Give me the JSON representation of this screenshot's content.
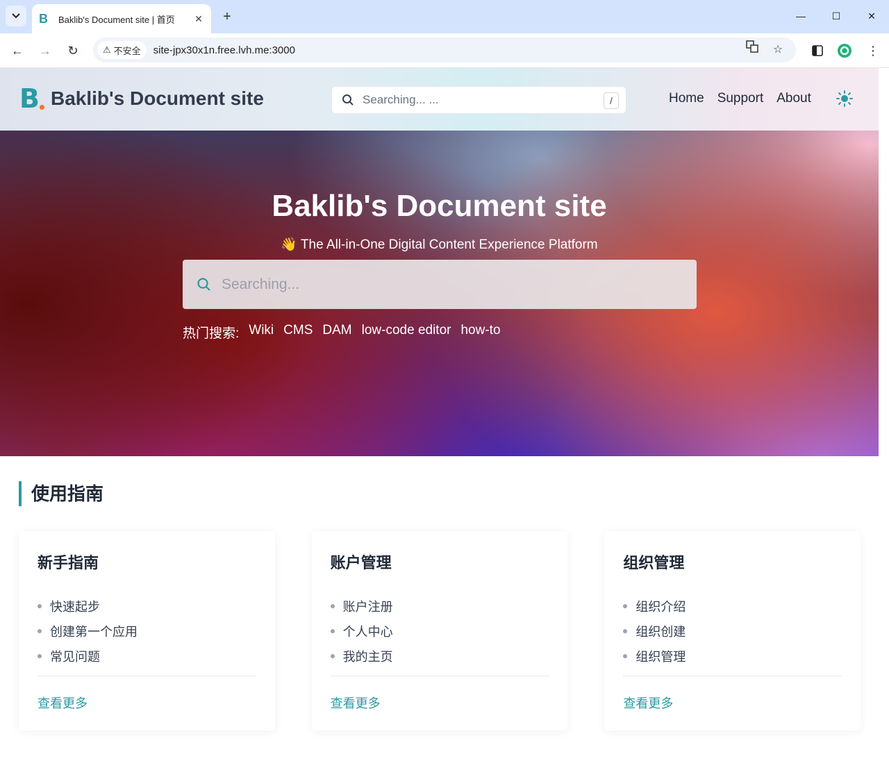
{
  "browser": {
    "tab_title": "Baklib's Document site | 首页",
    "security_label": "不安全",
    "url": "site-jpx30x1n.free.lvh.me:3000"
  },
  "header": {
    "logo_mark": "B",
    "site_name": "Baklib's Document site",
    "search_placeholder": "Searching... ...",
    "search_shortcut": "/",
    "nav": [
      "Home",
      "Support",
      "About"
    ]
  },
  "hero": {
    "title": "Baklib's Document site",
    "subtitle": "👋 The All-in-One Digital Content Experience Platform",
    "search_placeholder": "Searching...",
    "hot_label": "热门搜索:",
    "hot_terms": [
      "Wiki",
      "CMS",
      "DAM",
      "low-code editor",
      "how-to"
    ]
  },
  "guide": {
    "title": "使用指南",
    "cards": [
      {
        "title": "新手指南",
        "items": [
          "快速起步",
          "创建第一个应用",
          "常见问题"
        ],
        "more": "查看更多"
      },
      {
        "title": "账户管理",
        "items": [
          "账户注册",
          "个人中心",
          "我的主页"
        ],
        "more": "查看更多"
      },
      {
        "title": "组织管理",
        "items": [
          "组织介绍",
          "组织创建",
          "组织管理"
        ],
        "more": "查看更多"
      }
    ]
  },
  "colors": {
    "accent": "#2b9aa3",
    "logo_dot": "#f97316"
  }
}
